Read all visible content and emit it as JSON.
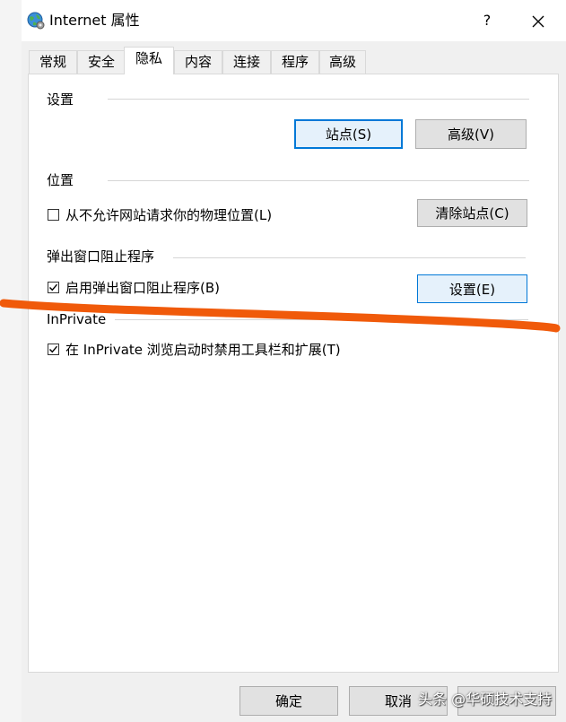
{
  "window": {
    "title": "Internet 属性",
    "help_label": "?",
    "icon": "globe-gear-icon"
  },
  "tabs": [
    {
      "label": "常规",
      "active": false
    },
    {
      "label": "安全",
      "active": false
    },
    {
      "label": "隐私",
      "active": true
    },
    {
      "label": "内容",
      "active": false
    },
    {
      "label": "连接",
      "active": false
    },
    {
      "label": "程序",
      "active": false
    },
    {
      "label": "高级",
      "active": false
    }
  ],
  "settings_group": {
    "title": "设置",
    "sites_button": "站点(S)",
    "advanced_button": "高级(V)"
  },
  "location_group": {
    "title": "位置",
    "never_allow_label": "从不允许网站请求你的物理位置(L)",
    "never_allow_checked": false,
    "clear_sites_button": "清除站点(C)"
  },
  "popup_group": {
    "title": "弹出窗口阻止程序",
    "enable_label": "启用弹出窗口阻止程序(B)",
    "enable_checked": true,
    "settings_button": "设置(E)"
  },
  "inprivate_group": {
    "title": "InPrivate",
    "disable_toolbars_label": "在 InPrivate 浏览启动时禁用工具栏和扩展(T)",
    "disable_toolbars_checked": true
  },
  "footer": {
    "ok_button": "确定",
    "cancel_button": "取消"
  },
  "watermark": "头条 @华硕技术支持",
  "colors": {
    "accent": "#0078d7",
    "scribble": "#f05a0a"
  }
}
